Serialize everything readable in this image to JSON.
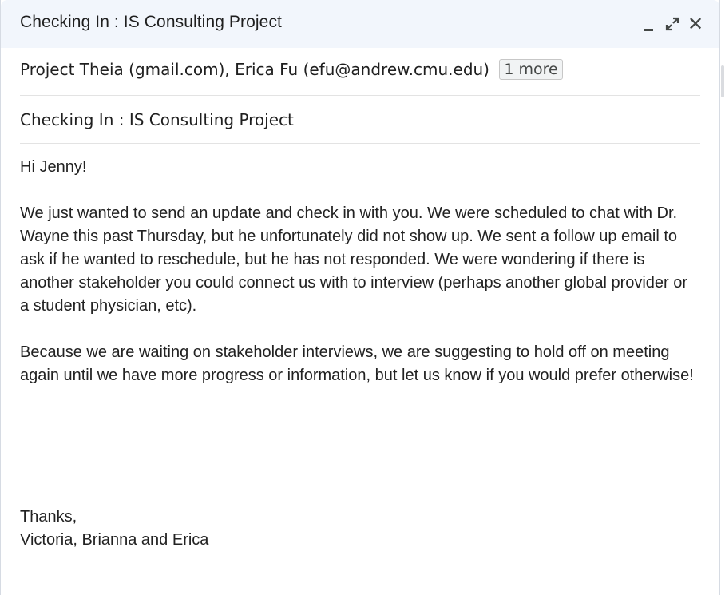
{
  "window": {
    "title": "Checking In : IS Consulting Project"
  },
  "controls": {
    "minimize_icon": "minimize-icon",
    "maximize_icon": "expand-icon",
    "close_glyph": "✕"
  },
  "recipients": {
    "primary": "Project Theia (gmail.com)",
    "separator": ", ",
    "secondary": "Erica Fu (efu@andrew.cmu.edu)",
    "more": "1 more"
  },
  "subject": "Checking In : IS Consulting Project",
  "message": {
    "greeting": "Hi Jenny!",
    "paragraph1": "We just wanted to send an update and check in with you. We were scheduled to chat with Dr. Wayne this past Thursday, but he unfortunately did not show up. We sent a follow up email to ask if he wanted to reschedule, but he has not responded. We were wondering if there is another stakeholder you could connect us with to interview (perhaps another global provider or a student physician, etc).",
    "paragraph2": "Because we are waiting on stakeholder interviews, we are suggesting to hold off on meeting again until we have more progress or information, but let us know if you would prefer otherwise!",
    "signoff": "Thanks,",
    "signature": "Victoria, Brianna and Erica"
  }
}
